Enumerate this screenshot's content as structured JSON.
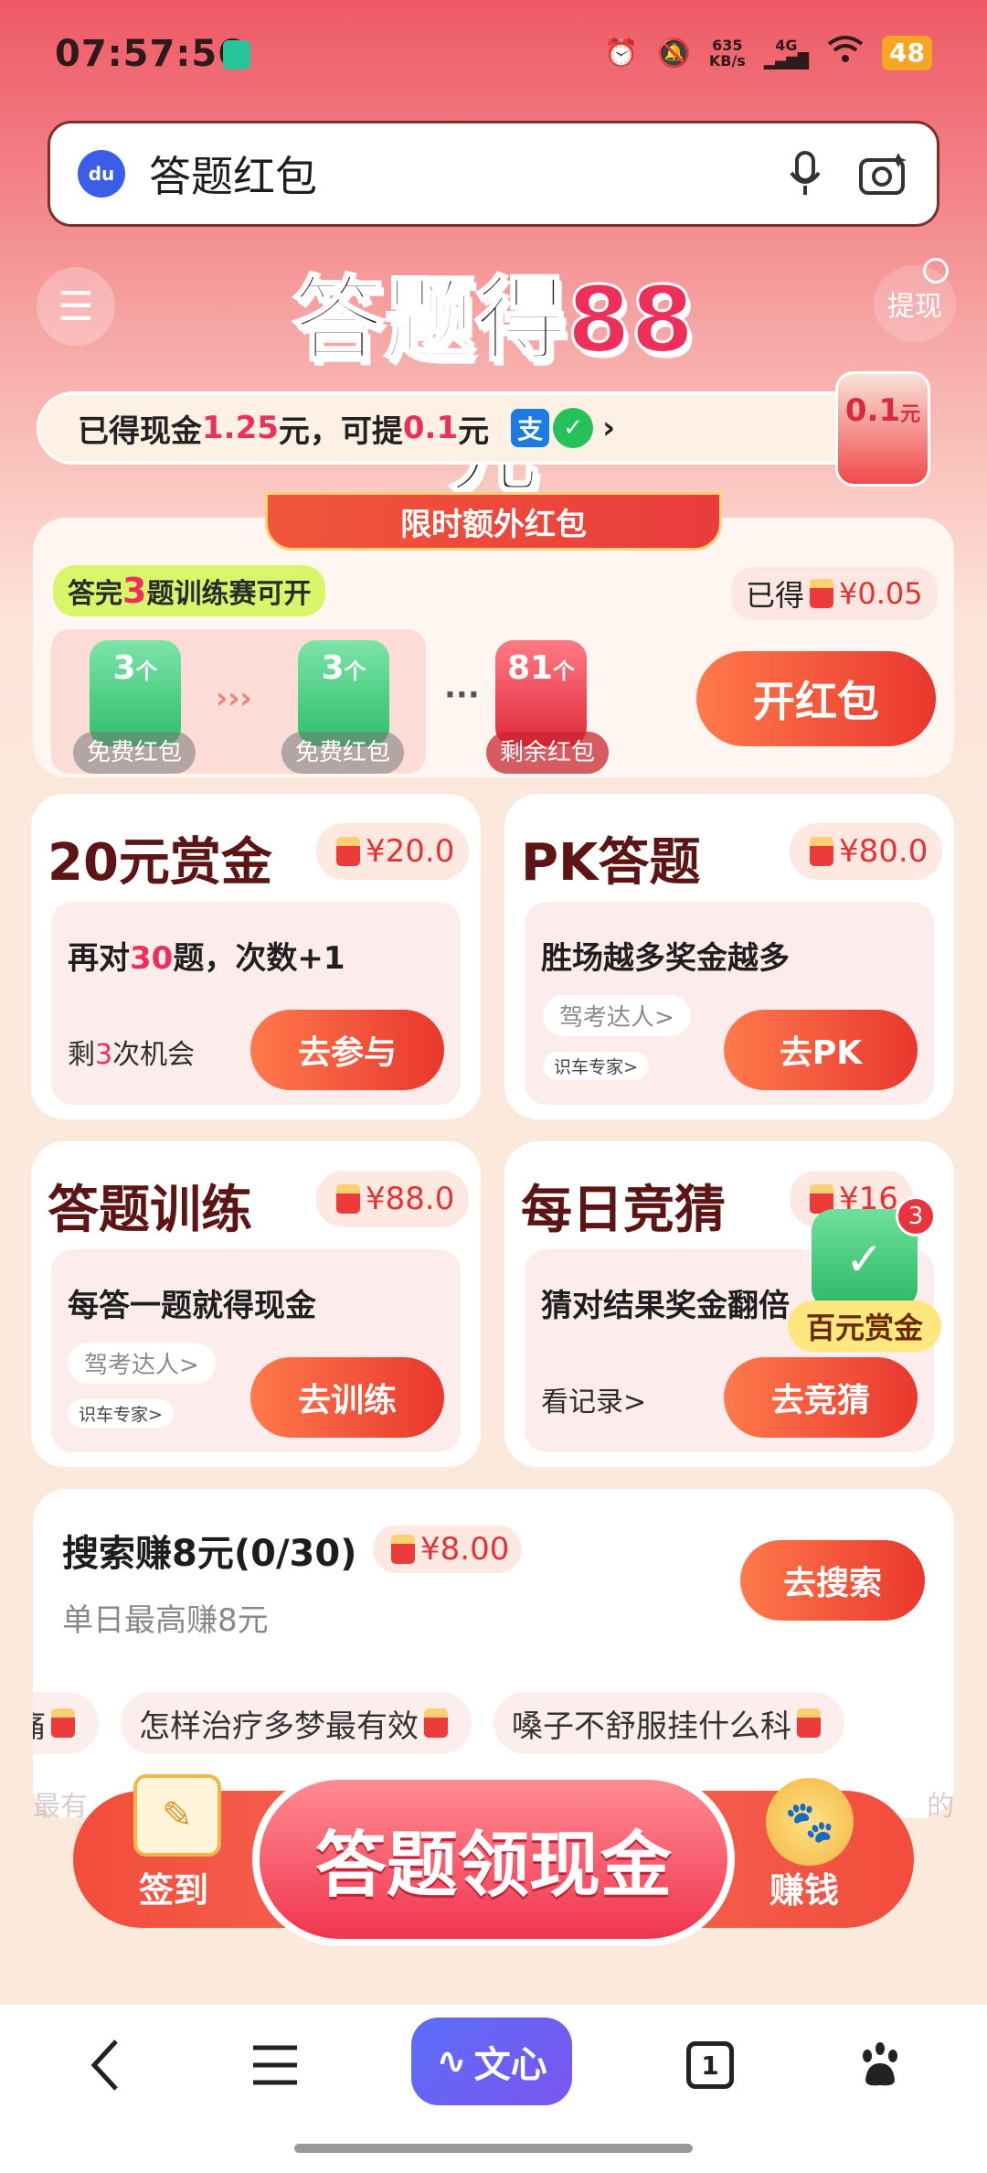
{
  "status_bar": {
    "time": "07:57:56",
    "net_speed": "635",
    "net_unit": "KB/s",
    "signal": "4G",
    "battery": "48"
  },
  "search": {
    "query": "答题红包"
  },
  "header": {
    "title_prefix": "答题得",
    "title_amount": "88",
    "title_suffix": "元",
    "withdraw_label": "提现"
  },
  "cash_bar": {
    "t1": "已得现金",
    "earned": "1.25",
    "t2": "元，可提",
    "withdrawable": "0.1",
    "t3": "元",
    "alipay_icon": "支",
    "envelope_amount": "0.1",
    "envelope_unit": "元"
  },
  "limited": {
    "ribbon": "限时额外红包",
    "tip_prefix": "答完",
    "tip_num": "3",
    "tip_suffix": "题训练赛可开",
    "earned_label": "已得",
    "earned_amount": "¥0.05",
    "tiers": [
      {
        "count": "3",
        "unit": "个",
        "label": "免费红包"
      },
      {
        "count": "3",
        "unit": "个",
        "label": "免费红包"
      },
      {
        "count": "81",
        "unit": "个",
        "label": "剩余红包"
      }
    ],
    "arrows": "›››",
    "dots": "···",
    "open_button": "开红包"
  },
  "tasks": [
    {
      "title": "20元赏金",
      "amount": "¥20.0",
      "line1_a": "再对",
      "line1_b": "30",
      "line1_c": "题，次数+1",
      "sub_a": "剩",
      "sub_b": "3",
      "sub_c": "次机会",
      "button": "去参与"
    },
    {
      "title": "PK答题",
      "amount": "¥80.0",
      "line1": "胜场越多奖金越多",
      "chip1": "驾考达人>",
      "chip2": "识车专家>",
      "button": "去PK"
    },
    {
      "title": "答题训练",
      "amount": "¥88.0",
      "line1": "每答一题就得现金",
      "chip1": "驾考达人>",
      "chip2": "识车专家>",
      "button": "去训练"
    },
    {
      "title": "每日竞猜",
      "amount": "¥16",
      "line1": "猜对结果奖金翻倍",
      "sub": "看记录>",
      "button": "去竞猜"
    }
  ],
  "float_widget": {
    "count": "3",
    "label": "百元赏金"
  },
  "search_task": {
    "title": "搜索赚8元(0/30)",
    "amount": "¥8.00",
    "subtitle": "单日最高赚8元",
    "button": "去搜索",
    "queries": [
      "痛",
      "怎样治疗多梦最有效",
      "嗓子不舒服挂什么科"
    ],
    "queries2": [
      "最有",
      "…",
      "的"
    ]
  },
  "cta": {
    "main": "答题领现金",
    "left": "签到",
    "right": "赚钱"
  },
  "bottom_nav": {
    "wenxin": "文心",
    "tabs_count": "1"
  }
}
